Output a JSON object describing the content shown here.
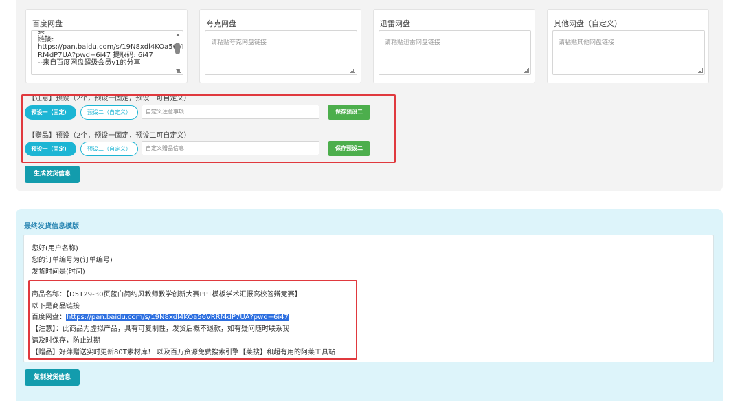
{
  "disks": [
    {
      "title": "百度网盘",
      "content": "链接: https://pan.baidu.com/s/19N8xdl4KOa56VRRf4dP7UA?pwd=6i47 提取码: 6i47\n--来自百度网盘超级会员v1的分享",
      "visible_lines": "赛\n链接:\nhttps://pan.baidu.com/s/19N8xdl4KOa56VR\nRf4dP7UA?pwd=6i47 提取码: 6i47\n--来自百度网盘超级会员v1的分享"
    },
    {
      "title": "夸克网盘",
      "placeholder": "请粘贴夸克网盘链接"
    },
    {
      "title": "迅雷网盘",
      "placeholder": "请粘贴迅雷网盘链接"
    },
    {
      "title": "其他网盘（自定义）",
      "placeholder": "请粘贴其他网盘链接"
    }
  ],
  "notice_preset": {
    "label": "【注意】预设（2个，预设一固定，预设二可自定义）",
    "preset1": "预设一（固定）",
    "preset2": "预设二（自定义）",
    "input_placeholder": "自定义注意事项",
    "save": "保存预设二"
  },
  "gift_preset": {
    "label": "【赠品】预设（2个，预设一固定，预设二可自定义）",
    "preset1": "预设一（固定）",
    "preset2": "预设二（自定义）",
    "input_placeholder": "自定义赠品信息",
    "save": "保存预设二"
  },
  "generate_button": "生成发货信息",
  "final": {
    "title": "最终发货信息模版",
    "greeting": "您好(用户名称)",
    "order_line": "您的订单编号为(订单编号)",
    "time_line": "发货时间是(时间)",
    "product_line": "商品名称：【D5129-30页蓝白简约风教师教学创新大赛PPT模板学术汇报高校答辩竞赛】",
    "link_intro": "以下是商品链接",
    "baidu_label": "百度网盘：",
    "baidu_link": "https://pan.baidu.com/s/19N8xdl4KOa56VRRf4dP7UA?pwd=6i47",
    "notice_line": "【注意】：此商品为虚拟产品，具有可复制性，发货后概不退款，如有疑问随时联系我",
    "save_line": "请及时保存，防止过期",
    "gift_line": "【赠品】好萍赠送实时更新80T素材库！ 以及百万资源免费搜索引擎【莱搜】和超有用的阿莱工具站"
  },
  "copy_button": "复制发货信息",
  "colors": {
    "accent": "#1cb5d4",
    "primary_btn": "#139cad",
    "save_green": "#4cae4c",
    "highlight_red": "#e0393e"
  }
}
